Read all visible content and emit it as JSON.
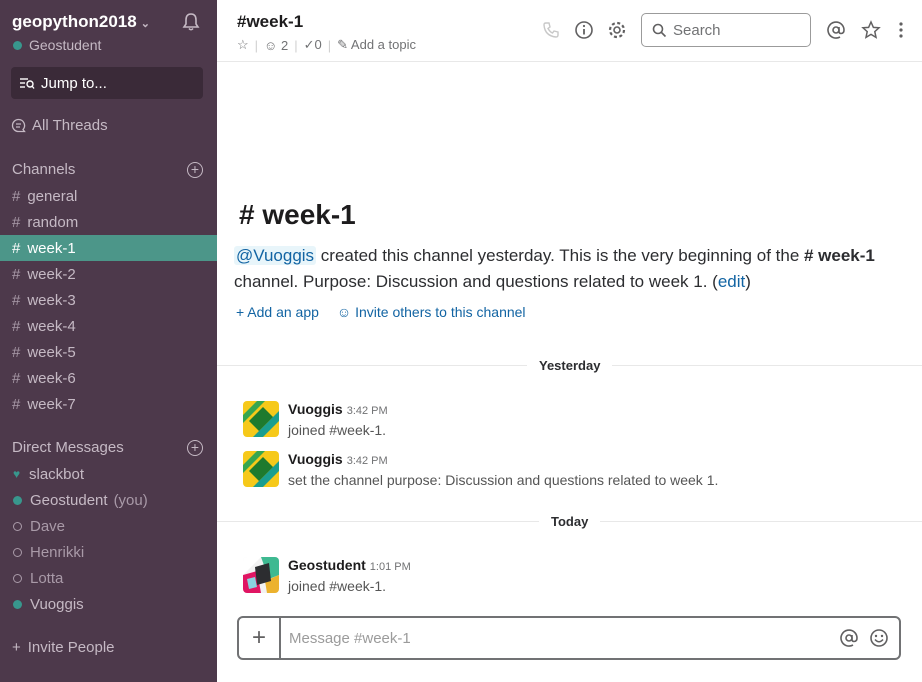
{
  "workspace": {
    "name": "geopython2018",
    "user": "Geostudent"
  },
  "sidebar": {
    "jump_label": "Jump to...",
    "all_threads": "All Threads",
    "channels_title": "Channels",
    "channels": [
      {
        "name": "general"
      },
      {
        "name": "random"
      },
      {
        "name": "week-1",
        "active": true
      },
      {
        "name": "week-2"
      },
      {
        "name": "week-3"
      },
      {
        "name": "week-4"
      },
      {
        "name": "week-5"
      },
      {
        "name": "week-6"
      },
      {
        "name": "week-7"
      }
    ],
    "dm_title": "Direct Messages",
    "dms": [
      {
        "name": "slackbot",
        "status": "heart"
      },
      {
        "name": "Geostudent",
        "suffix": "(you)",
        "status": "online"
      },
      {
        "name": "Dave",
        "status": "offline"
      },
      {
        "name": "Henrikki",
        "status": "offline"
      },
      {
        "name": "Lotta",
        "status": "offline"
      },
      {
        "name": "Vuoggis",
        "status": "online"
      }
    ],
    "invite": "Invite People"
  },
  "header": {
    "title": "#week-1",
    "members": "2",
    "pins": "0",
    "topic": "Add a topic",
    "search_placeholder": "Search"
  },
  "intro": {
    "title": "week-1",
    "hash": "#",
    "mention": "@Vuoggis",
    "text1": " created this channel yesterday. This is the very beginning of the ",
    "channel_ref": "# week-1",
    "text2": " channel. Purpose: Discussion and questions related to week 1. (",
    "edit": "edit",
    "text3": ")",
    "add_app": "Add an app",
    "invite_others": "Invite others to this channel"
  },
  "dividers": {
    "yesterday": "Yesterday",
    "today": "Today"
  },
  "messages": [
    {
      "author": "Vuoggis",
      "time": "3:42 PM",
      "text": "joined #week-1."
    },
    {
      "author": "Vuoggis",
      "time": "3:42 PM",
      "text": "set the channel purpose: Discussion and questions related to week 1."
    },
    {
      "author": "Geostudent",
      "time": "1:01 PM",
      "text": "joined #week-1."
    }
  ],
  "composer": {
    "placeholder": "Message #week-1"
  }
}
